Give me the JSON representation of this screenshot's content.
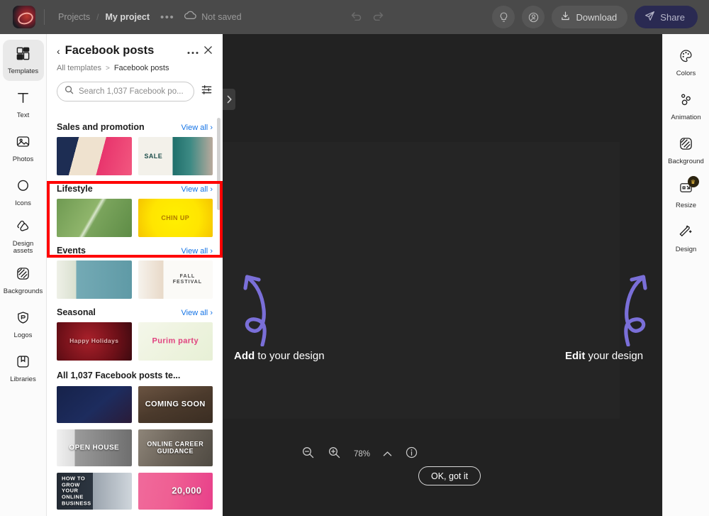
{
  "topbar": {
    "logo_icon": "creative-cloud-logo",
    "projects_label": "Projects",
    "separator": "/",
    "project_name": "My project",
    "more_label": "•••",
    "cloud_icon": "cloud-icon",
    "save_status": "Not saved",
    "undo_icon": "undo-icon",
    "redo_icon": "redo-icon",
    "help_icon": "lightbulb-icon",
    "account_icon": "account-add-icon",
    "download_icon": "download-icon",
    "download_label": "Download",
    "share_icon": "share-send-icon",
    "share_label": "Share"
  },
  "left_rail": {
    "items": [
      {
        "label": "Templates",
        "icon": "templates-icon",
        "active": true
      },
      {
        "label": "Text",
        "icon": "text-icon",
        "active": false
      },
      {
        "label": "Photos",
        "icon": "photos-icon",
        "active": false
      },
      {
        "label": "Icons",
        "icon": "icons-icon",
        "active": false
      },
      {
        "label": "Design assets",
        "icon": "design-assets-icon",
        "active": false
      },
      {
        "label": "Backgrounds",
        "icon": "backgrounds-icon",
        "active": false
      },
      {
        "label": "Logos",
        "icon": "logos-icon",
        "active": false
      },
      {
        "label": "Libraries",
        "icon": "libraries-icon",
        "active": false
      }
    ]
  },
  "panel": {
    "back_icon": "chevron-left-icon",
    "title": "Facebook posts",
    "more_icon": "more-horizontal-icon",
    "close_icon": "close-icon",
    "breadcrumb": {
      "root": "All templates",
      "separator": ">",
      "current": "Facebook posts"
    },
    "search": {
      "icon": "search-icon",
      "placeholder": "Search 1,037 Facebook po...",
      "value": "",
      "filter_icon": "filter-sliders-icon"
    },
    "view_all_label": "View all",
    "view_all_chevron": "›",
    "sections": [
      {
        "title": "Sales and promotion",
        "view_all": "View all",
        "thumbs": [
          {
            "name": "sales-promo-template-1",
            "art": "a1",
            "caption": ""
          },
          {
            "name": "sales-promo-template-2",
            "art": "a2",
            "caption": "SALE"
          }
        ]
      },
      {
        "title": "Lifestyle",
        "view_all": "View all",
        "highlighted": true,
        "thumbs": [
          {
            "name": "lifestyle-template-1",
            "art": "a3",
            "caption": ""
          },
          {
            "name": "lifestyle-template-2",
            "art": "a4",
            "caption": "CHIN UP"
          }
        ]
      },
      {
        "title": "Events",
        "view_all": "View all",
        "thumbs": [
          {
            "name": "events-template-1",
            "art": "a5",
            "caption": ""
          },
          {
            "name": "events-template-2",
            "art": "a6",
            "caption": "FALL FESTIVAL"
          }
        ]
      },
      {
        "title": "Seasonal",
        "view_all": "View all",
        "thumbs": [
          {
            "name": "seasonal-template-1",
            "art": "a7",
            "caption": "Happy Holidays"
          },
          {
            "name": "seasonal-template-2",
            "art": "a8",
            "caption": "Purim party"
          }
        ]
      }
    ],
    "all_grid": {
      "title": "All 1,037 Facebook posts te...",
      "items": [
        {
          "name": "template-card-1",
          "art": "b1",
          "caption": ""
        },
        {
          "name": "template-card-2",
          "art": "b2",
          "caption": "COMING SOON"
        },
        {
          "name": "template-card-3",
          "art": "b3",
          "caption": "OPEN HOUSE"
        },
        {
          "name": "template-card-4",
          "art": "b4",
          "caption": "ONLINE CAREER GUIDANCE"
        },
        {
          "name": "template-card-5",
          "art": "b5",
          "caption": "HOW TO GROW YOUR ONLINE BUSINESS"
        },
        {
          "name": "template-card-6",
          "art": "b6",
          "caption": "20,000"
        }
      ]
    },
    "toggle_icon": "chevron-right-icon"
  },
  "right_rail": {
    "items": [
      {
        "label": "Colors",
        "icon": "colors-palette-icon",
        "badge": ""
      },
      {
        "label": "Animation",
        "icon": "animation-icon",
        "badge": ""
      },
      {
        "label": "Background",
        "icon": "background-icon",
        "badge": ""
      },
      {
        "label": "Resize",
        "icon": "resize-icon",
        "badge": "crown-icon"
      },
      {
        "label": "Design",
        "icon": "design-wand-icon",
        "badge": ""
      }
    ]
  },
  "canvas": {
    "tip_add": {
      "bold": "Add",
      "rest": " to your design",
      "arrow_icon": "curly-arrow-up-left-icon"
    },
    "tip_edit": {
      "bold": "Edit",
      "rest": " your design",
      "arrow_icon": "curly-arrow-up-right-icon"
    },
    "zoom": {
      "zoom_out_icon": "zoom-out-icon",
      "zoom_in_icon": "zoom-in-icon",
      "level": "78%",
      "chevron_icon": "chevron-up-icon",
      "info_icon": "info-icon"
    },
    "ok_button": "OK, got it"
  },
  "colors": {
    "accent_purple": "#7a6fd8",
    "highlight_red": "#ff0000",
    "link_blue": "#1473e6",
    "share_bg": "#2a2a52",
    "canvas_bg": "#3b3b3b",
    "panel_bg": "#ffffff"
  }
}
